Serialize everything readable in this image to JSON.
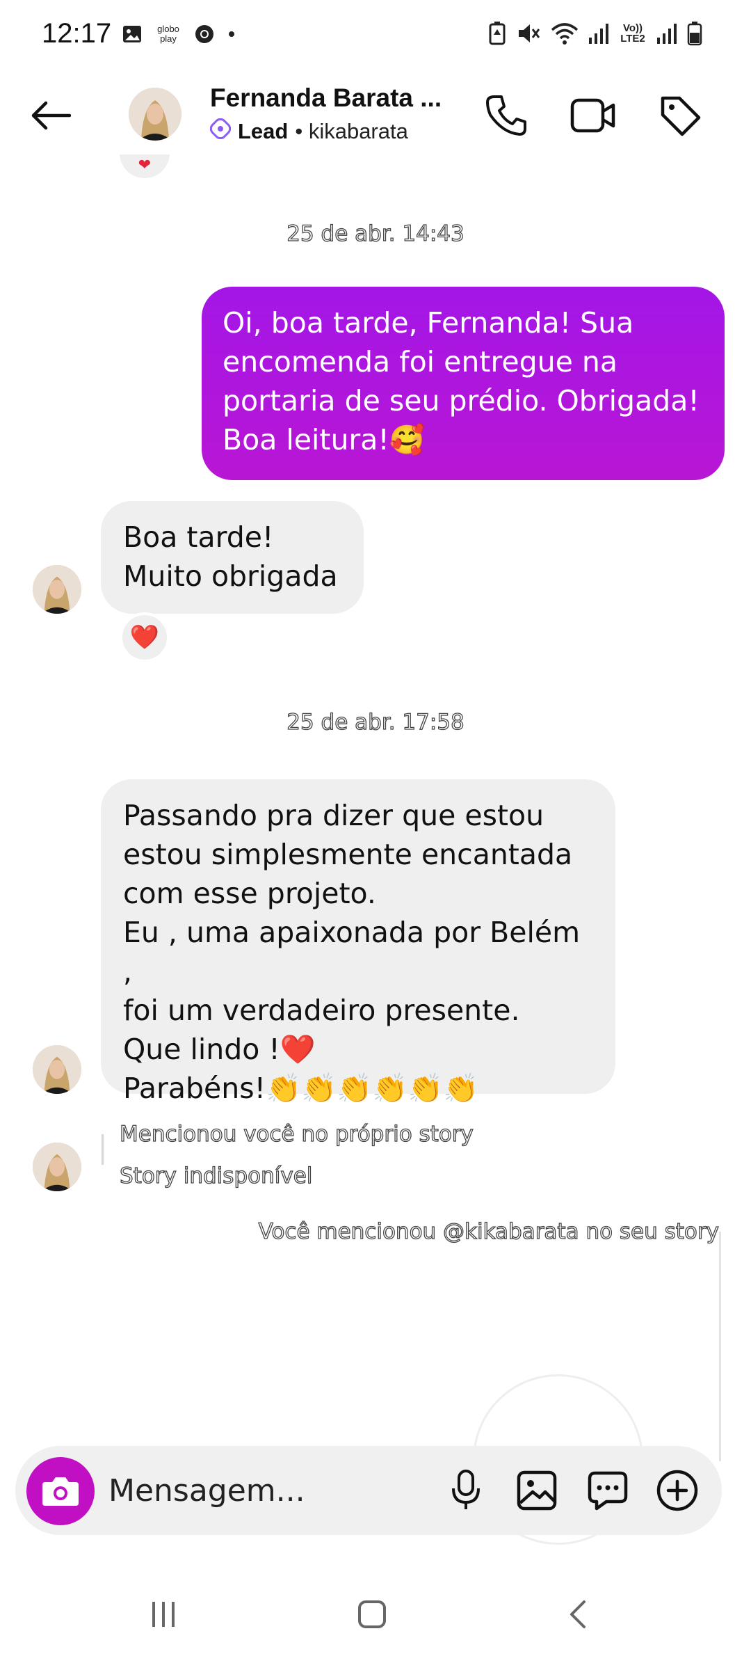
{
  "status_bar": {
    "time": "12:17",
    "left_icons": [
      "gallery-icon",
      "globoplay-icon",
      "chrome-icon",
      "dot-icon"
    ],
    "globoplay_text": "globo play",
    "right_icons": [
      "battery-saver-icon",
      "mute-icon",
      "wifi-icon",
      "signal-icon",
      "volte-icon",
      "signal-icon",
      "battery-icon"
    ],
    "volte_text": "Vo)) LTE2"
  },
  "header": {
    "contact_name": "Fernanda Barata ...",
    "label": "Lead",
    "username": "• kikabarata",
    "icons": [
      "back-arrow-icon",
      "phone-icon",
      "video-icon",
      "tag-icon"
    ]
  },
  "messages": {
    "timestamp_1": "25 de abr. 14:43",
    "outgoing_1": "Oi, boa tarde, Fernanda! Sua encomenda foi entregue na portaria de seu prédio. Obrigada! Boa leitura!🥰",
    "incoming_1": "Boa tarde!\nMuito obrigada",
    "reaction_1": "❤️",
    "timestamp_2": "25 de abr. 17:58",
    "incoming_2": "Passando pra dizer que estou\nestou simplesmente encantada\ncom esse projeto.\nEu , uma apaixonada por Belém ,\nfoi um verdadeiro presente.\nQue lindo !❤️\nParabéns!👏👏👏👏👏👏",
    "mention_1": "Mencionou você no próprio story",
    "story_unavailable": "Story indisponível",
    "mention_2": "Você mencionou @kikabarata no seu story"
  },
  "composer": {
    "placeholder": "Mensagem...",
    "icons": [
      "camera-icon",
      "microphone-icon",
      "gallery-icon",
      "chat-bubble-icon",
      "plus-circle-icon"
    ]
  },
  "colors": {
    "outgoing_bubble": "#a316e6",
    "camera_button": "#c10fc4",
    "incoming_bubble": "#efefef",
    "lead_badge": "#8b5cf6"
  }
}
